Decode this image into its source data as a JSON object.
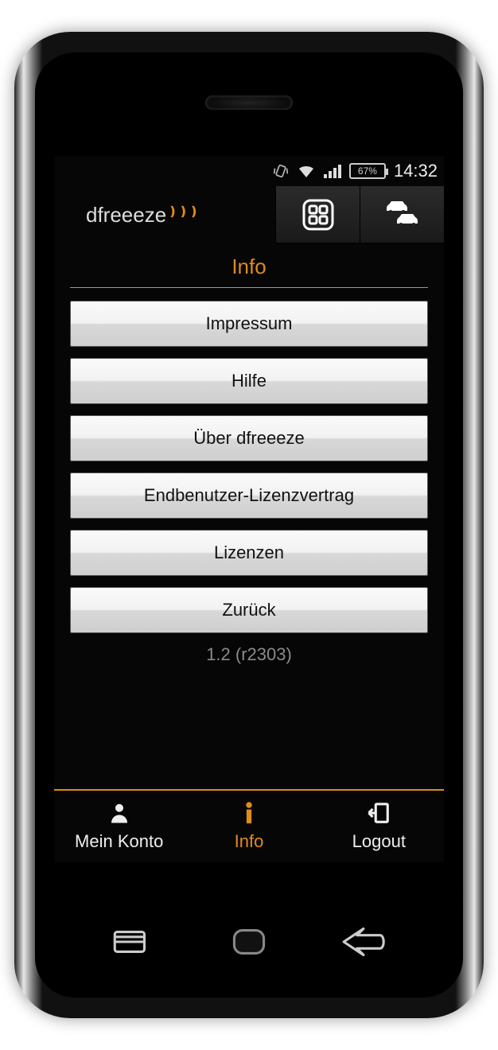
{
  "status": {
    "battery": "67%",
    "time": "14:32"
  },
  "brand": "dfreeeze",
  "page": {
    "title": "Info",
    "buttons": [
      "Impressum",
      "Hilfe",
      "Über dfreeeze",
      "Endbenutzer-Lizenzvertrag",
      "Lizenzen",
      "Zurück"
    ],
    "version": "1.2 (r2303)"
  },
  "tabs": {
    "account": "Mein Konto",
    "info": "Info",
    "logout": "Logout"
  }
}
